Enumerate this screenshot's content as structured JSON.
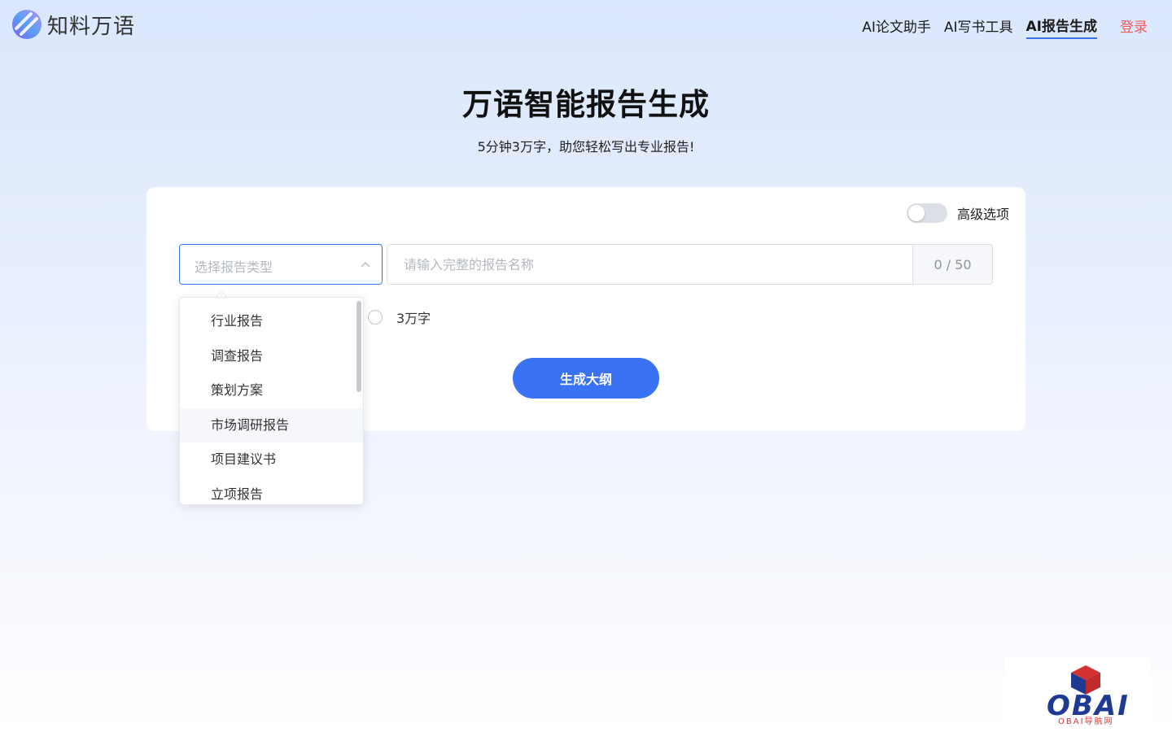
{
  "brand": {
    "name": "知料万语"
  },
  "nav": {
    "items": [
      "AI论文助手",
      "AI写书工具",
      "AI报告生成"
    ],
    "active_index": 2,
    "login": "登录"
  },
  "hero": {
    "title": "万语智能报告生成",
    "subtitle": "5分钟3万字，助您轻松写出专业报告!"
  },
  "form": {
    "advanced_label": "高级选项",
    "advanced_on": false,
    "type_placeholder": "选择报告类型",
    "name_placeholder": "请输入完整的报告名称",
    "name_count": "0 / 50",
    "word_option": "3万字",
    "generate_label": "生成大纲"
  },
  "dropdown": {
    "open": true,
    "hover_index": 3,
    "options": [
      "行业报告",
      "调查报告",
      "策划方案",
      "市场调研报告",
      "项目建议书",
      "立项报告"
    ]
  },
  "watermark": {
    "text": "OBAI",
    "sub": "OBAI导航网"
  },
  "colors": {
    "accent": "#3a72f6",
    "login": "#f15b5b",
    "watermark_blue": "#1f3a93",
    "watermark_red": "#d33333"
  }
}
